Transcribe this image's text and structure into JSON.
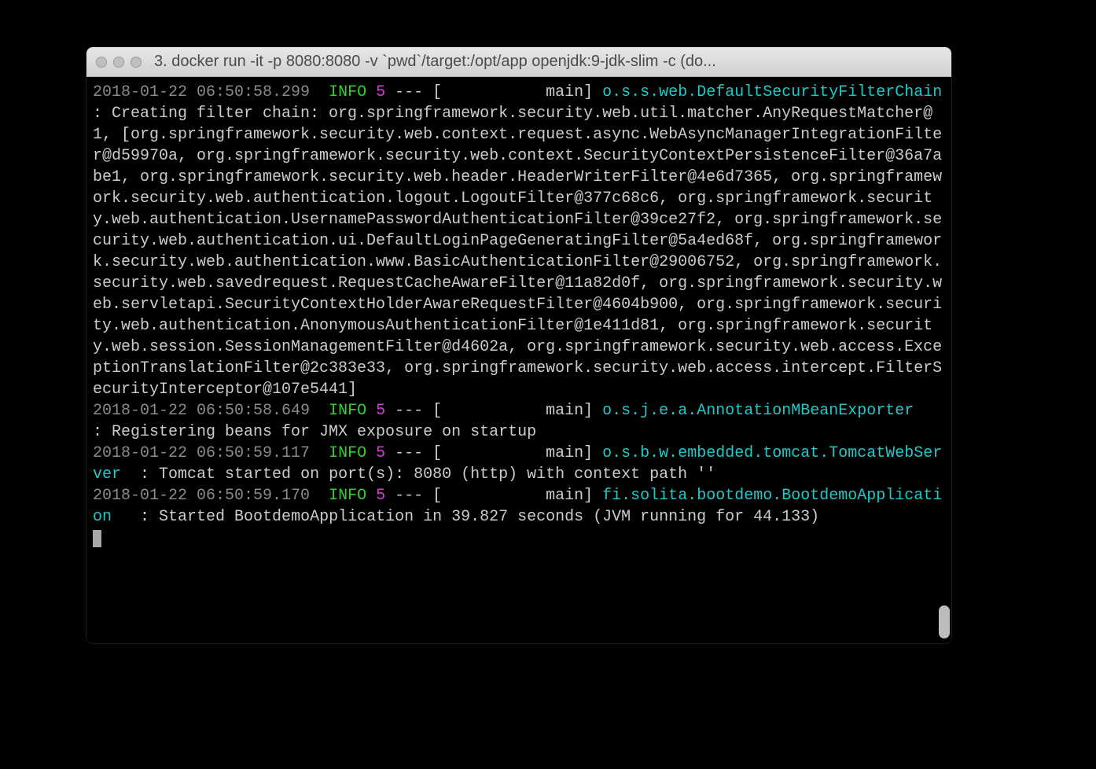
{
  "window": {
    "title": "3. docker run -it -p 8080:8080 -v `pwd`/target:/opt/app openjdk:9-jdk-slim  -c  (do..."
  },
  "log": {
    "entries": [
      {
        "ts": "2018-01-22 06:50:58.299",
        "level": "INFO",
        "pid": "5",
        "sep": " --- [           ",
        "thread": "main] ",
        "class": "o.s.s.web.DefaultSecurityFilterChain",
        "classPad": "     ",
        "msg": ": Creating filter chain: org.springframework.security.web.util.matcher.AnyRequestMatcher@1, [org.springframework.security.web.context.request.async.WebAsyncManagerIntegrationFilter@d59970a, org.springframework.security.web.context.SecurityContextPersistenceFilter@36a7abe1, org.springframework.security.web.header.HeaderWriterFilter@4e6d7365, org.springframework.security.web.authentication.logout.LogoutFilter@377c68c6, org.springframework.security.web.authentication.UsernamePasswordAuthenticationFilter@39ce27f2, org.springframework.security.web.authentication.ui.DefaultLoginPageGeneratingFilter@5a4ed68f, org.springframework.security.web.authentication.www.BasicAuthenticationFilter@29006752, org.springframework.security.web.savedrequest.RequestCacheAwareFilter@11a82d0f, org.springframework.security.web.servletapi.SecurityContextHolderAwareRequestFilter@4604b900, org.springframework.security.web.authentication.AnonymousAuthenticationFilter@1e411d81, org.springframework.security.web.session.SessionManagementFilter@d4602a, org.springframework.security.web.access.ExceptionTranslationFilter@2c383e33, org.springframework.security.web.access.intercept.FilterSecurityInterceptor@107e5441]"
      },
      {
        "ts": "2018-01-22 06:50:58.649",
        "level": "INFO",
        "pid": "5",
        "sep": " --- [           ",
        "thread": "main] ",
        "class": "o.s.j.e.a.AnnotationMBeanExporter",
        "classPad": "        ",
        "msg": ": Registering beans for JMX exposure on startup"
      },
      {
        "ts": "2018-01-22 06:50:59.117",
        "level": "INFO",
        "pid": "5",
        "sep": " --- [           ",
        "thread": "main] ",
        "class": "o.s.b.w.embedded.tomcat.TomcatWebServer",
        "classPad": "  ",
        "msg": ": Tomcat started on port(s): 8080 (http) with context path ''"
      },
      {
        "ts": "2018-01-22 06:50:59.170",
        "level": "INFO",
        "pid": "5",
        "sep": " --- [           ",
        "thread": "main] ",
        "class": "fi.solita.bootdemo.BootdemoApplication",
        "classPad": "   ",
        "msg": ": Started BootdemoApplication in 39.827 seconds (JVM running for 44.133)"
      }
    ]
  }
}
